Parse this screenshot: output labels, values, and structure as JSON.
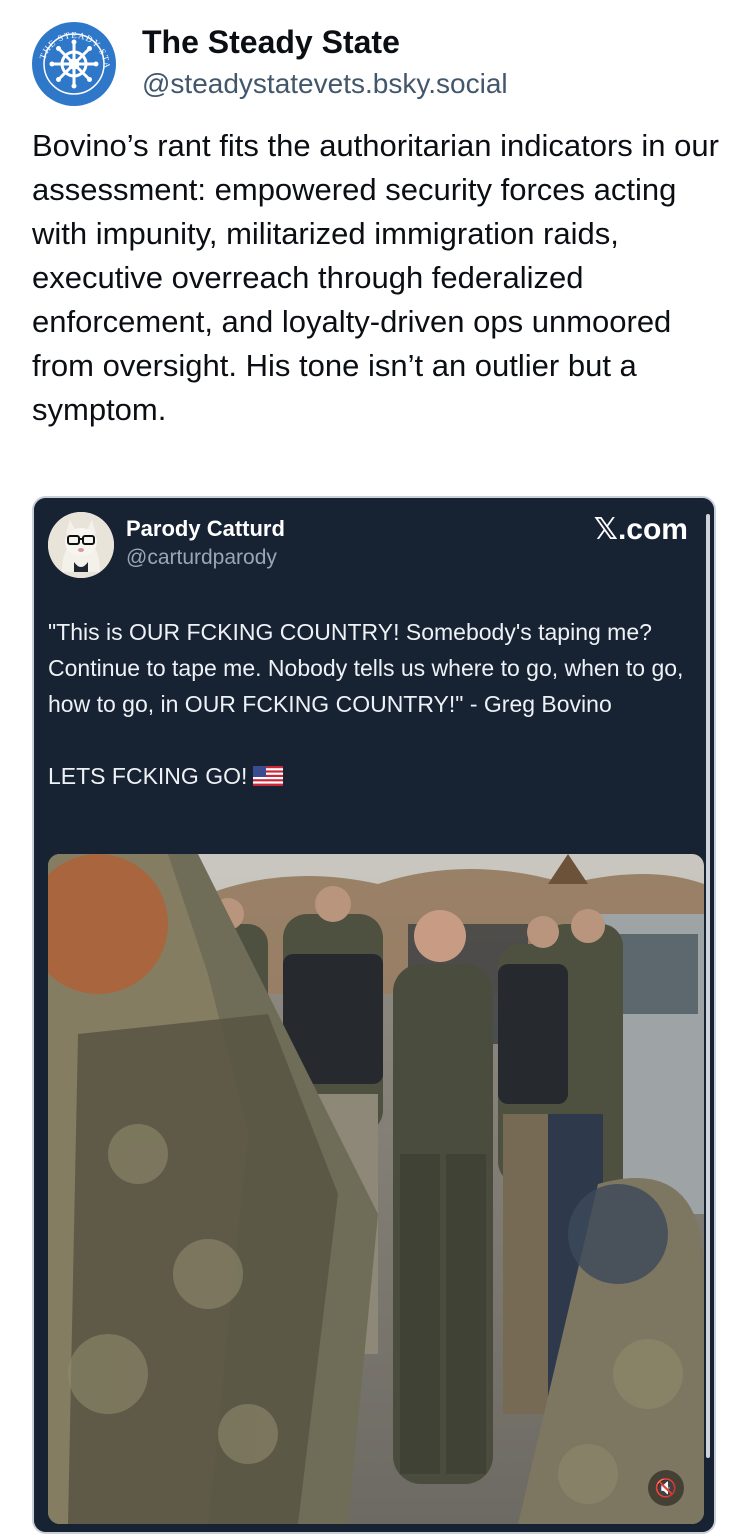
{
  "post": {
    "author_name": "The Steady State",
    "author_handle": "@steadystatevets.bsky.social",
    "avatar_ring_text": "THE STEADY STATE",
    "text": "Bovino’s rant fits the authoritarian indicators in our assessment: empowered security forces acting with impunity, militarized immigration raids, executive overreach through federalized enforcement, and loyalty-driven ops unmoored from oversight. His tone isn’t an outlier but a symptom."
  },
  "embed": {
    "author_name": "Parody Catturd",
    "author_handle": "@carturdparody",
    "source_label": "𝕏.com",
    "quote_text": "\"This is OUR FCKING COUNTRY! Somebody's taping me? Continue to tape me. Nobody tells us where to go, when to go, how to go, in OUR FCKING COUNTRY!\"  - Greg Bovino",
    "tagline": "LETS FCKING GO!",
    "mute_icon": "🔇"
  },
  "colors": {
    "brand_blue": "#2f78c9",
    "embed_bg": "#172233",
    "handle_gray": "#42576c"
  }
}
